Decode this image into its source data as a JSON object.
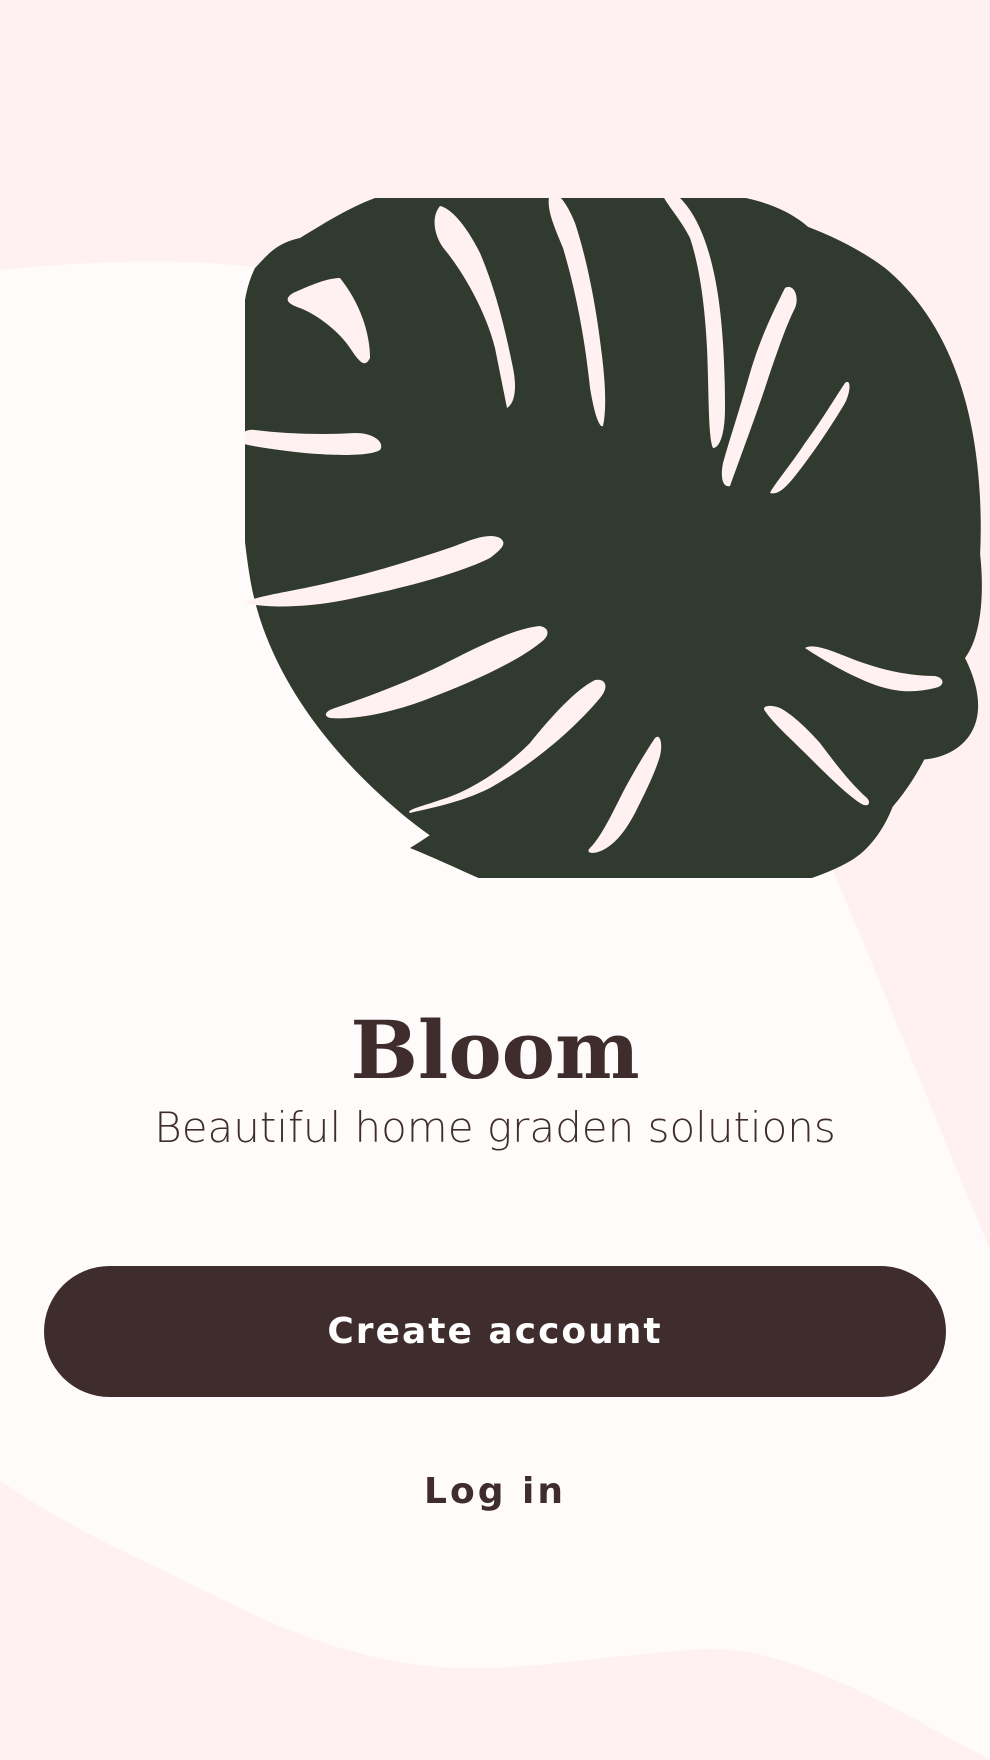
{
  "app": {
    "title": "Bloom",
    "subtitle": "Beautiful home graden solutions"
  },
  "actions": {
    "create_account_label": "Create account",
    "login_label": "Log in"
  },
  "illustration": {
    "icon": "monstera-leaf-icon"
  },
  "colors": {
    "primary": "#3F2C2D",
    "background": "#FFF1F1",
    "surface": "#FFFBFA",
    "leaf": "#303A2F",
    "on_primary": "#FFFFFF"
  }
}
